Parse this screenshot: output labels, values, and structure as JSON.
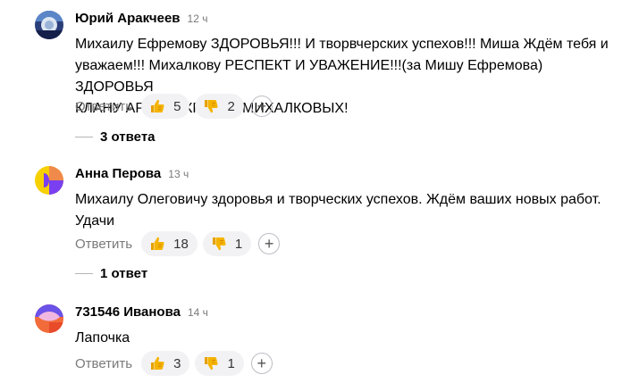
{
  "comments": [
    {
      "author": "Юрий Аракчеев",
      "time": "12 ч",
      "text_lines": [
        "Михаилу Ефремову ЗДОРОВЬЯ!!! И творвчерских успехов!!! Миша Ждём тебя и",
        "уважаем!!! Михалкову РЕСПЕКТ И УВАЖЕНИЕ!!!(за Мишу Ефремова) ЗДОРОВЬЯ",
        "КЛАНУ АРИСТОКРАТОВ МИХАЛКОВЫХ!"
      ],
      "reply_label": "Ответить",
      "likes": "5",
      "dislikes": "2",
      "add_reaction": "+",
      "thread_label": "3 ответа"
    },
    {
      "author": "Анна Перова",
      "time": "13 ч",
      "text_lines": [
        "Михаилу Олеговичу здоровья и творческих успехов. Ждём ваших новых работ.",
        "Удачи"
      ],
      "reply_label": "Ответить",
      "likes": "18",
      "dislikes": "1",
      "add_reaction": "+",
      "thread_label": "1 ответ"
    },
    {
      "author": "731546 Иванова",
      "time": "14 ч",
      "text_lines": [
        "Лапочка"
      ],
      "reply_label": "Ответить",
      "likes": "3",
      "dislikes": "1",
      "add_reaction": "+"
    }
  ],
  "icons": {
    "like": "thumbs-up-icon",
    "dislike": "thumbs-down-icon",
    "add": "plus-icon"
  },
  "colors": {
    "reaction_bg": "#f2f2f5",
    "emoji_yellow": "#f5b400",
    "muted_text": "#7a7a7a"
  }
}
